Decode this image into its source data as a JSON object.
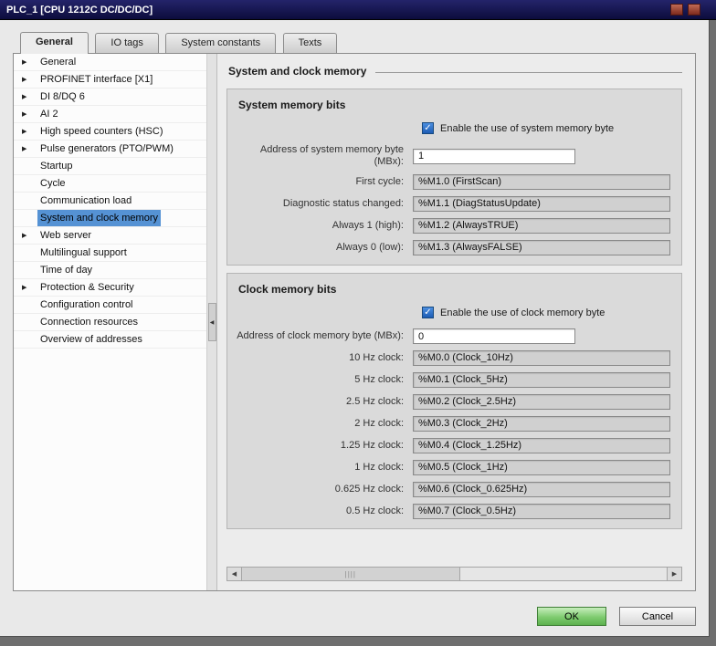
{
  "window": {
    "title": "PLC_1 [CPU 1212C DC/DC/DC]"
  },
  "icons": {
    "chevron_right": "▶",
    "collapse_left": "◀",
    "scroll_left": "◀",
    "scroll_right": "▶",
    "check": "✓",
    "grip": "||||"
  },
  "tabs": [
    {
      "label": "General",
      "active": true
    },
    {
      "label": "IO tags"
    },
    {
      "label": "System constants"
    },
    {
      "label": "Texts"
    }
  ],
  "sidebar": {
    "items": [
      {
        "label": "General",
        "expandable": true
      },
      {
        "label": "PROFINET interface [X1]",
        "expandable": true
      },
      {
        "label": "DI 8/DQ 6",
        "expandable": true
      },
      {
        "label": "AI 2",
        "expandable": true
      },
      {
        "label": "High speed counters (HSC)",
        "expandable": true
      },
      {
        "label": "Pulse generators (PTO/PWM)",
        "expandable": true
      },
      {
        "label": "Startup"
      },
      {
        "label": "Cycle"
      },
      {
        "label": "Communication load"
      },
      {
        "label": "System and clock memory",
        "selected": true
      },
      {
        "label": "Web server",
        "expandable": true
      },
      {
        "label": "Multilingual support"
      },
      {
        "label": "Time of day"
      },
      {
        "label": "Protection & Security",
        "expandable": true
      },
      {
        "label": "Configuration control"
      },
      {
        "label": "Connection resources"
      },
      {
        "label": "Overview of addresses"
      }
    ]
  },
  "main": {
    "heading": "System and clock memory",
    "system_section": {
      "title": "System memory bits",
      "enabled": true,
      "enable_label": "Enable the use of system memory byte",
      "address_label": "Address of system memory byte (MBx):",
      "address_value": "1",
      "fields": [
        {
          "label": "First cycle:",
          "value": "%M1.0 (FirstScan)"
        },
        {
          "label": "Diagnostic status changed:",
          "value": "%M1.1 (DiagStatusUpdate)"
        },
        {
          "label": "Always 1 (high):",
          "value": "%M1.2 (AlwaysTRUE)"
        },
        {
          "label": "Always 0 (low):",
          "value": "%M1.3 (AlwaysFALSE)"
        }
      ]
    },
    "clock_section": {
      "title": "Clock memory bits",
      "enabled": true,
      "enable_label": "Enable the use of clock memory byte",
      "address_label": "Address of clock memory byte (MBx):",
      "address_value": "0",
      "fields": [
        {
          "label": "10 Hz clock:",
          "value": "%M0.0 (Clock_10Hz)"
        },
        {
          "label": "5 Hz clock:",
          "value": "%M0.1 (Clock_5Hz)"
        },
        {
          "label": "2.5 Hz clock:",
          "value": "%M0.2 (Clock_2.5Hz)"
        },
        {
          "label": "2 Hz clock:",
          "value": "%M0.3 (Clock_2Hz)"
        },
        {
          "label": "1.25 Hz clock:",
          "value": "%M0.4 (Clock_1.25Hz)"
        },
        {
          "label": "1 Hz clock:",
          "value": "%M0.5 (Clock_1Hz)"
        },
        {
          "label": "0.625 Hz clock:",
          "value": "%M0.6 (Clock_0.625Hz)"
        },
        {
          "label": "0.5 Hz clock:",
          "value": "%M0.7 (Clock_0.5Hz)"
        }
      ]
    }
  },
  "footer": {
    "ok": "OK",
    "cancel": "Cancel"
  },
  "colors": {
    "title_bar": "#14144e",
    "selection_blue": "#5592d4",
    "checkbox_blue": "#1d5cb4",
    "ok_green": "#7ecb6f"
  }
}
